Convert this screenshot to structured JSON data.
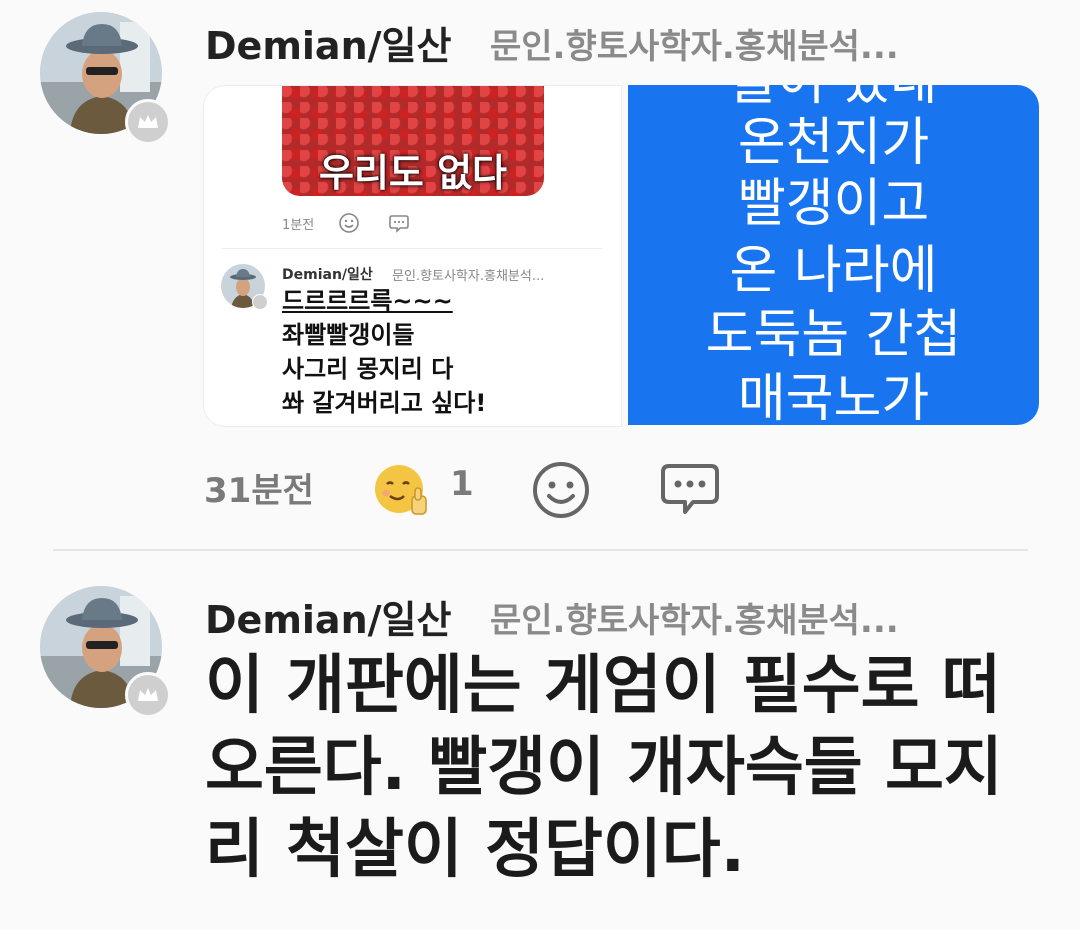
{
  "post1": {
    "author_name": "Demian/일산",
    "author_subtitle": "문인.향토사학자.홍채분석...",
    "embedded": {
      "image_caption": "우리도 없다",
      "time": "1분전",
      "reply_name": "Demian/일산",
      "reply_subtitle": "문인.향토사학자.홍채분석...",
      "reply_lines": [
        "드르르르륵~~~",
        "좌빨빨갱이들",
        "사그리 몽지리 다",
        "쏴 갈겨버리고 싶다!"
      ]
    },
    "blue_image_lines": [
      "들어 있네",
      "온천지가",
      "빨갱이고",
      "온 나라에",
      "도둑놈 간첩",
      "매국노가"
    ],
    "time": "31분전",
    "reaction_count": "1"
  },
  "post2": {
    "author_name": "Demian/일산",
    "author_subtitle": "문인.향토사학자.홍채분석...",
    "body": "이 개판에는 게엄이 필수로 떠오른다. 빨갱이 개자슥들 모지리 척살이 정답이다."
  },
  "colors": {
    "background": "#fafafa",
    "blue_image": "#1875ef",
    "reaction_emoji": "#f4c542",
    "muted_text": "#8a8a8a"
  },
  "icons": {
    "crown": "crown-icon",
    "reaction": "thumbs-up-smiley-icon",
    "add_reaction": "smiley-icon",
    "comment": "comment-icon"
  }
}
